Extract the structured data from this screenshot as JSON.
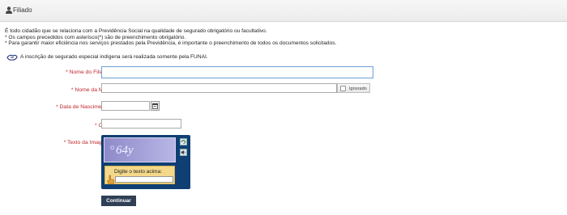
{
  "header": {
    "title": "Filiado"
  },
  "intro": {
    "line1": "É todo cidadão que se relaciona com a Previdência Social na qualidade de segurado obrigatório ou facultativo.",
    "line2": "* Os campos precedidos com asterisco(*) são de preenchimento obrigatório.",
    "line3": "* Para garantir maior eficiência nos serviços prestados pela Previdência, é importante o preenchimento de todos os documentos solicitados."
  },
  "note": "A inscrição de segurado especial indígena será realizada somente pela FUNAI.",
  "form": {
    "nome_filiado": {
      "label": "* Nome do Filiado:",
      "value": ""
    },
    "nome_mae": {
      "label": "* Nome da Mãe:",
      "value": "",
      "ignorado_label": "Ignorado"
    },
    "data_nascimento": {
      "label": "* Data de Nascimento:",
      "value": ""
    },
    "cpf": {
      "label": "* CPF:",
      "value": ""
    },
    "texto_imagem": {
      "label": "* Texto da Imagem:",
      "captcha_text": "64y",
      "prompt": "Digite o texto acima:",
      "value": ""
    }
  },
  "actions": {
    "continuar": "Continuar"
  },
  "colors": {
    "label_red": "#c0262b",
    "button_bg": "#2f3f55",
    "captcha_bg": "#0f3f73"
  }
}
